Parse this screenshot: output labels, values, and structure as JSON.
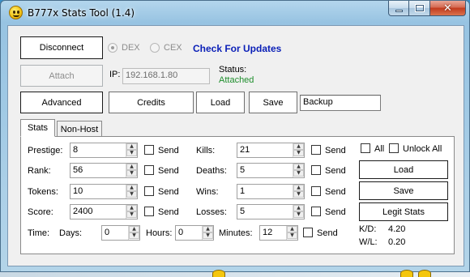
{
  "window": {
    "title": "B777x Stats Tool (1.4)",
    "caption": {
      "close": "✕"
    }
  },
  "toolbar": {
    "disconnect_label": "Disconnect",
    "attach_label": "Attach",
    "ip_label": "IP:",
    "ip_value": "192.168.1.80",
    "status_label": "Status:",
    "status_value": "Attached",
    "dex_label": "DEX",
    "cex_label": "CEX",
    "update_link": "Check For Updates",
    "advanced_label": "Advanced",
    "credits_label": "Credits",
    "load_label": "Load",
    "save_label": "Save",
    "profile_value": "Backup"
  },
  "tabs": [
    {
      "label": "Stats",
      "active": true
    },
    {
      "label": "Non-Host",
      "active": false
    }
  ],
  "stats": {
    "left": [
      {
        "label": "Prestige:",
        "value": "8",
        "send_label": "Send"
      },
      {
        "label": "Rank:",
        "value": "56",
        "send_label": "Send"
      },
      {
        "label": "Tokens:",
        "value": "10",
        "send_label": "Send"
      },
      {
        "label": "Score:",
        "value": "2400",
        "send_label": "Send"
      }
    ],
    "right": [
      {
        "label": "Kills:",
        "value": "21",
        "send_label": "Send"
      },
      {
        "label": "Deaths:",
        "value": "5",
        "send_label": "Send"
      },
      {
        "label": "Wins:",
        "value": "1",
        "send_label": "Send"
      },
      {
        "label": "Losses:",
        "value": "5",
        "send_label": "Send"
      }
    ],
    "time": {
      "label": "Time:",
      "days_label": "Days:",
      "days_value": "0",
      "hours_label": "Hours:",
      "hours_value": "0",
      "minutes_label": "Minutes:",
      "minutes_value": "12",
      "send_label": "Send"
    },
    "all_label": "All",
    "unlock_all_label": "Unlock All",
    "load_label": "Load",
    "save_label": "Save",
    "legit_label": "Legit Stats",
    "kd_label": "K/D:",
    "kd_value": "4.20",
    "wl_label": "W/L:",
    "wl_value": "0.20"
  },
  "colors": {
    "link": "#0a1fb7",
    "status_ok": "#1e8e2c",
    "close_button": "#c23a1d"
  }
}
